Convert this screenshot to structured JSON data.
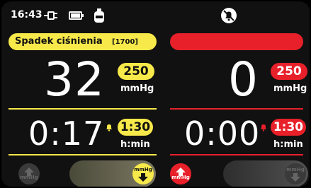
{
  "status_bar": {
    "time": "16:43",
    "icons": [
      "plug-icon",
      "battery-icon",
      "mains-bottle-icon",
      "alarm-muted-icon"
    ]
  },
  "left_channel": {
    "alarm_label": "Spadek ciśnienia",
    "alarm_code": "[1700]",
    "pressure_value": "32",
    "pressure_limit": "250",
    "pressure_unit": "mmHg",
    "timer_value": "0:17",
    "timer_limit": "1:30",
    "timer_unit": "h:min",
    "up_button_unit": "mmHg",
    "down_button_unit": "mmHg"
  },
  "right_channel": {
    "pressure_value": "0",
    "pressure_limit": "250",
    "pressure_unit": "mmHg",
    "timer_value": "0:00",
    "timer_limit": "1:30",
    "timer_unit": "h:min",
    "up_button_unit": "mmHg",
    "down_button_unit": "mmHg"
  },
  "colors": {
    "accent_yellow": "#f7e94a",
    "accent_red": "#e8202a"
  }
}
